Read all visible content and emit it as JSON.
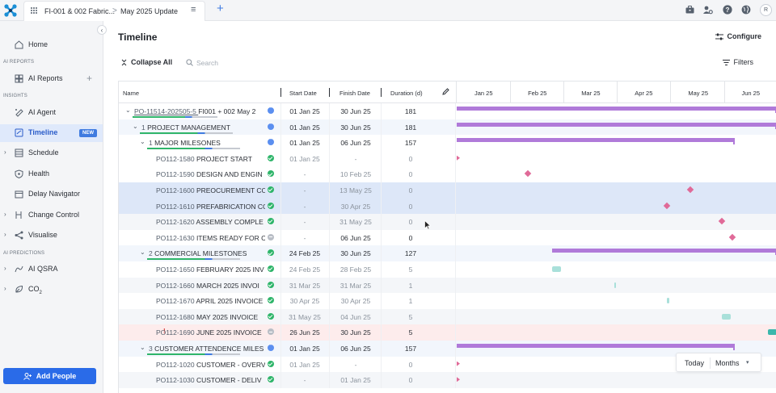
{
  "topbar": {
    "breadcrumb_project": "FI-001 & 002 Fabric...",
    "breadcrumb_sep": ">",
    "breadcrumb_update": "May 2025 Update",
    "add_tab_label": "+",
    "avatar_initial": "R"
  },
  "sidebar": {
    "home": "Home",
    "section_ai_reports": "AI REPORTS",
    "ai_reports": "AI Reports",
    "section_insights": "INSIGHTS",
    "ai_agent": "AI Agent",
    "timeline": "Timeline",
    "timeline_badge": "NEW",
    "schedule": "Schedule",
    "health": "Health",
    "delay_navigator": "Delay Navigator",
    "change_control": "Change Control",
    "visualise": "Visualise",
    "section_ai_predictions": "AI PREDICTIONS",
    "ai_qsra": "AI QSRA",
    "co2": "CO",
    "co2_sub": "2",
    "add_people": "Add People"
  },
  "main": {
    "title": "Timeline",
    "configure": "Configure",
    "collapse_all": "Collapse All",
    "search_placeholder": "Search",
    "filters": "Filters"
  },
  "grid": {
    "headers": {
      "name": "Name",
      "start": "Start Date",
      "finish": "Finish Date",
      "duration": "Duration (d)"
    },
    "months": [
      "Jan 25",
      "Feb 25",
      "Mar 25",
      "Apr 25",
      "May 25",
      "Jun 25"
    ],
    "rows": [
      {
        "code": "PO-11514-202505-5",
        "name": "FI001 + 002 May 2",
        "start": "01 Jan 25",
        "finish": "30 Jun 25",
        "duration": "181"
      },
      {
        "code": "1",
        "name": "PROJECT MANAGEMENT",
        "start": "01 Jan 25",
        "finish": "30 Jun 25",
        "duration": "181"
      },
      {
        "code": "1",
        "name": "MAJOR MILESONES",
        "start": "01 Jan 25",
        "finish": "06 Jun 25",
        "duration": "157"
      },
      {
        "code": "PO112-1580",
        "name": "PROJECT START",
        "start": "01 Jan 25",
        "finish": "-",
        "duration": "0"
      },
      {
        "code": "PO112-1590",
        "name": "DESIGN AND ENGIN",
        "start": "-",
        "finish": "10 Feb 25",
        "duration": "0"
      },
      {
        "code": "PO112-1600",
        "name": "PREOCUREMENT CO",
        "start": "-",
        "finish": "13 May 25",
        "duration": "0"
      },
      {
        "code": "PO112-1610",
        "name": "PREFABRICATION CO",
        "start": "-",
        "finish": "30 Apr 25",
        "duration": "0"
      },
      {
        "code": "PO112-1620",
        "name": "ASSEMBLY COMPLE",
        "start": "-",
        "finish": "31 May 25",
        "duration": "0"
      },
      {
        "code": "PO112-1630",
        "name": "ITEMS READY FOR C",
        "start": "-",
        "finish": "06 Jun 25",
        "duration": "0"
      },
      {
        "code": "2",
        "name": "COMMERCIAL MILESTONES",
        "start": "24 Feb 25",
        "finish": "30 Jun 25",
        "duration": "127"
      },
      {
        "code": "PO112-1650",
        "name": "FEBRUARY 2025 INV",
        "start": "24 Feb 25",
        "finish": "28 Feb 25",
        "duration": "5"
      },
      {
        "code": "PO112-1660",
        "name": "MARCH 2025 INVOI",
        "start": "31 Mar 25",
        "finish": "31 Mar 25",
        "duration": "1"
      },
      {
        "code": "PO112-1670",
        "name": "APRIL 2025 INVOICE",
        "start": "30 Apr 25",
        "finish": "30 Apr 25",
        "duration": "1"
      },
      {
        "code": "PO112-1680",
        "name": "MAY 2025 INVOICE",
        "start": "31 May 25",
        "finish": "04 Jun 25",
        "duration": "5"
      },
      {
        "code": "PO112-1690",
        "name": "JUNE 2025 INVOICE",
        "start": "26 Jun 25",
        "finish": "30 Jun 25",
        "duration": "5",
        "alert": "!"
      },
      {
        "code": "3",
        "name": "CUSTOMER ATTENDENCE MILES",
        "start": "01 Jan 25",
        "finish": "06 Jun 25",
        "duration": "157"
      },
      {
        "code": "PO112-1020",
        "name": "CUSTOMER - OVERV",
        "start": "01 Jan 25",
        "finish": "-",
        "duration": "0"
      },
      {
        "code": "PO112-1030",
        "name": "CUSTOMER - DELIV",
        "start": "-",
        "finish": "01 Jan 25",
        "duration": "0"
      }
    ]
  },
  "time_control": {
    "today": "Today",
    "scale": "Months"
  },
  "colors": {
    "summary_bar": "#b07ad9",
    "milestone": "#e06a98",
    "task_bar": "#a9e0da",
    "accent": "#2a6be8",
    "selected_row": "#dde7f8",
    "alert_row": "#fdecec"
  }
}
